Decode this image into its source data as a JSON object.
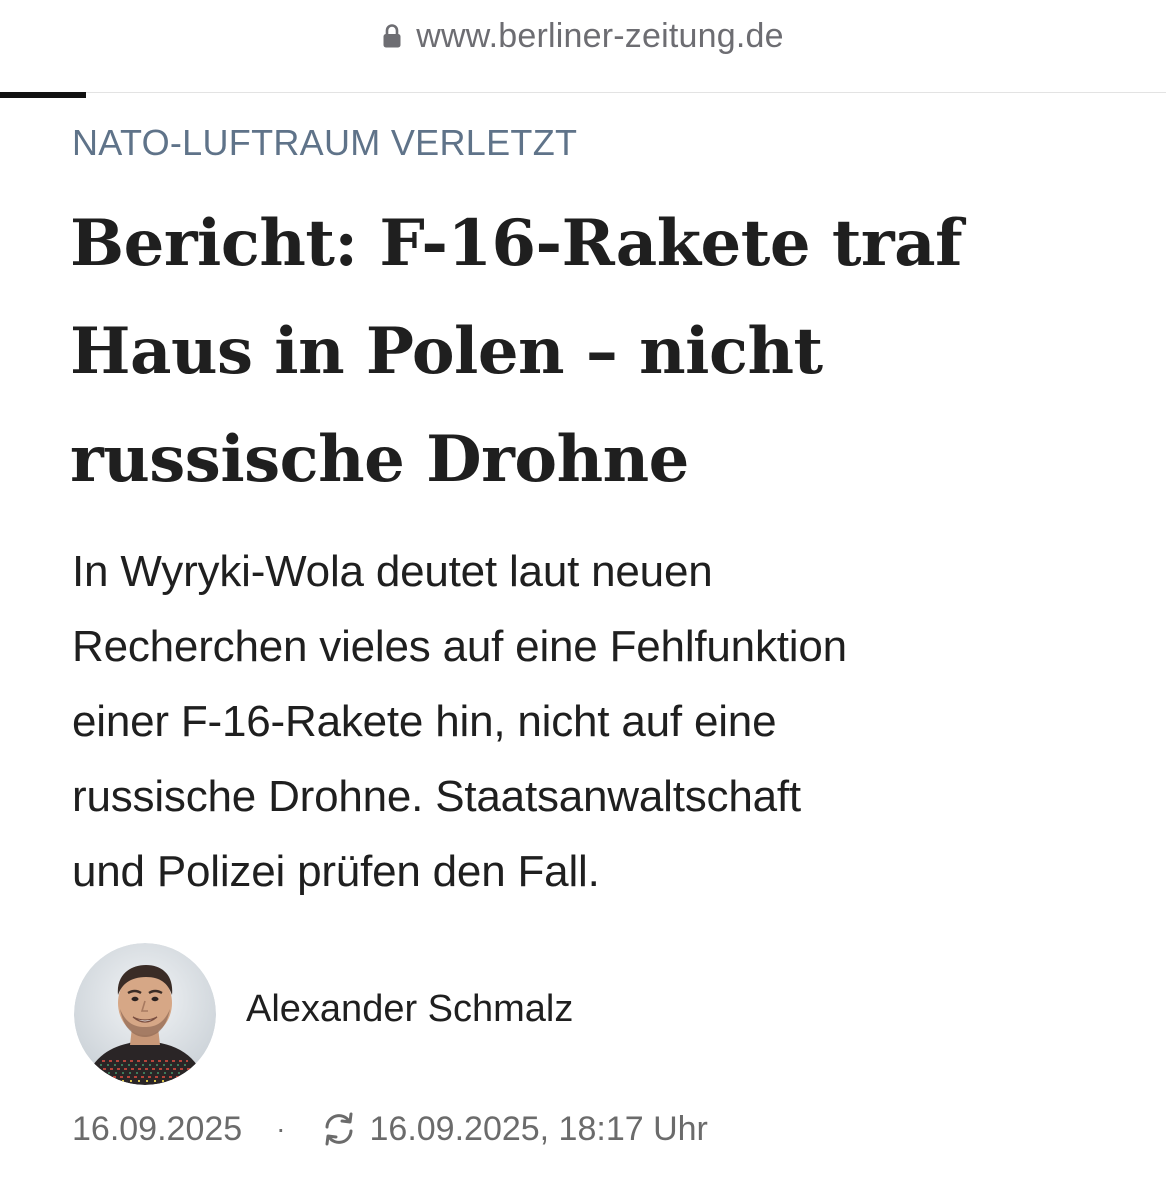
{
  "browser": {
    "url": "www.berliner-zeitung.de",
    "lock_icon": "lock-icon"
  },
  "article": {
    "kicker": "NATO-LUFTRAUM VERLETZT",
    "headline_lines": [
      "Bericht: F-16-Rakete traf",
      "Haus in Polen – nicht",
      "russische Drohne"
    ],
    "lead_lines": [
      "In Wyryki-Wola deutet laut neuen",
      "Recherchen vieles auf eine Fehlfunktion",
      "einer F-16-Rakete hin, nicht auf eine",
      "russische Drohne. Staatsanwaltschaft",
      "und Polizei prüfen den Fall."
    ]
  },
  "author": {
    "name": "Alexander Schmalz",
    "avatar_icon": "author-avatar"
  },
  "meta": {
    "published": "16.09.2025",
    "separator": "·",
    "updated_icon": "refresh-icon",
    "updated": "16.09.2025, 18:17 Uhr"
  },
  "colors": {
    "kicker": "#5f7389",
    "text": "#1f1f1f",
    "meta": "#6b6b6b",
    "url": "#6d6d72"
  }
}
